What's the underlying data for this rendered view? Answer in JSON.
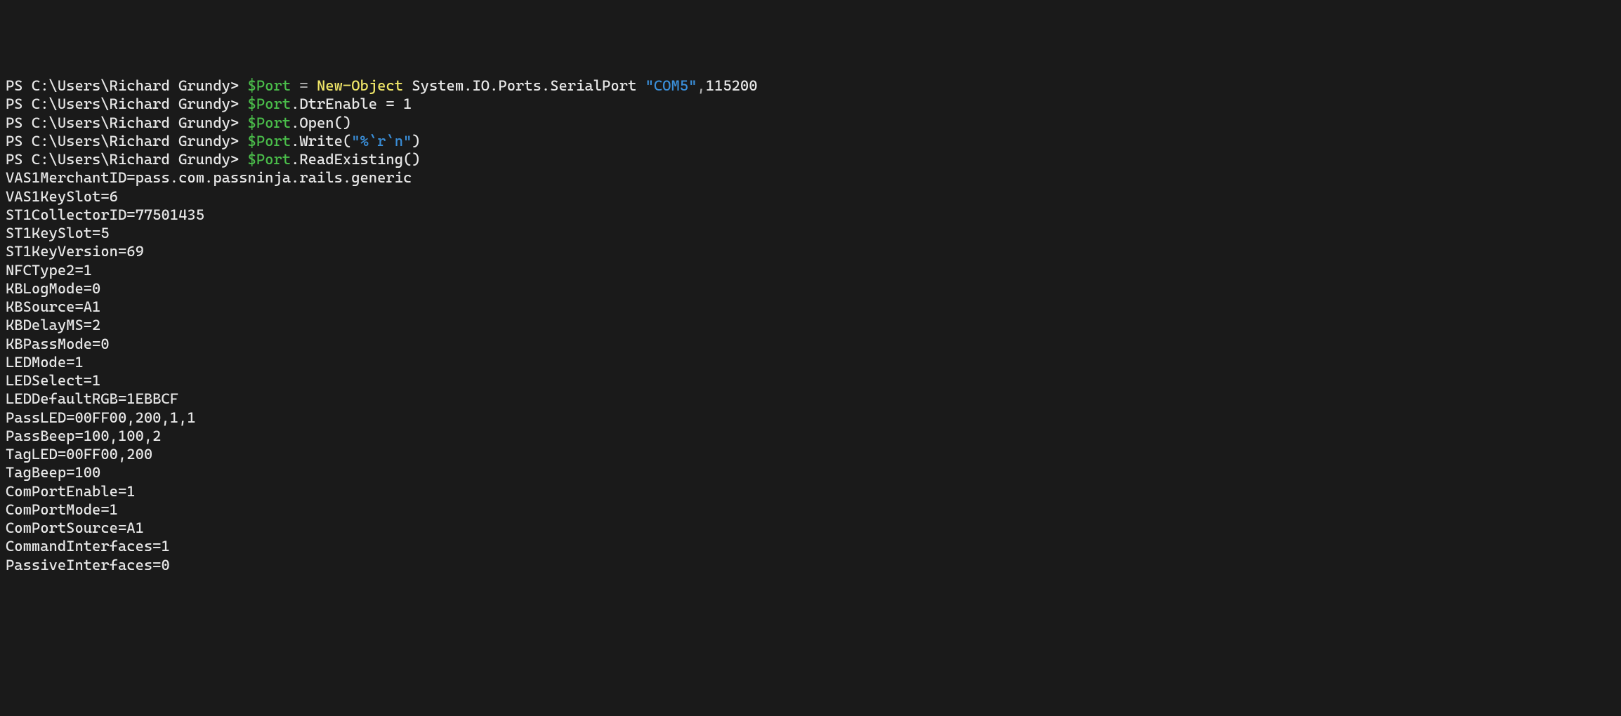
{
  "commands": [
    {
      "prompt": "PS C:\\Users\\Richard Grundy> ",
      "parts": [
        {
          "text": "$Port",
          "cls": "variable"
        },
        {
          "text": " = ",
          "cls": "operator"
        },
        {
          "text": "New-Object",
          "cls": "cmdlet"
        },
        {
          "text": " System.IO.Ports.SerialPort ",
          "cls": "type"
        },
        {
          "text": "\"COM5\"",
          "cls": "string"
        },
        {
          "text": ",",
          "cls": "operator"
        },
        {
          "text": "115200",
          "cls": "number"
        }
      ]
    },
    {
      "prompt": "PS C:\\Users\\Richard Grundy> ",
      "parts": [
        {
          "text": "$Port",
          "cls": "variable"
        },
        {
          "text": ".DtrEnable = ",
          "cls": "method"
        },
        {
          "text": "1",
          "cls": "number"
        }
      ]
    },
    {
      "prompt": "PS C:\\Users\\Richard Grundy> ",
      "parts": [
        {
          "text": "$Port",
          "cls": "variable"
        },
        {
          "text": ".Open()",
          "cls": "method"
        }
      ]
    },
    {
      "prompt": "PS C:\\Users\\Richard Grundy> ",
      "parts": [
        {
          "text": "$Port",
          "cls": "variable"
        },
        {
          "text": ".Write(",
          "cls": "method"
        },
        {
          "text": "\"%`r`n\"",
          "cls": "string"
        },
        {
          "text": ")",
          "cls": "paren"
        }
      ]
    },
    {
      "prompt": "PS C:\\Users\\Richard Grundy> ",
      "parts": [
        {
          "text": "$Port",
          "cls": "variable"
        },
        {
          "text": ".ReadExisting()",
          "cls": "method"
        }
      ]
    }
  ],
  "output": [
    "VAS1MerchantID=pass.com.passninja.rails.generic",
    "VAS1KeySlot=6",
    "ST1CollectorID=77501435",
    "ST1KeySlot=5",
    "ST1KeyVersion=69",
    "NFCType2=1",
    "KBLogMode=0",
    "KBSource=A1",
    "KBDelayMS=2",
    "KBPassMode=0",
    "LEDMode=1",
    "LEDSelect=1",
    "LEDDefaultRGB=1EBBCF",
    "PassLED=00FF00,200,1,1",
    "PassBeep=100,100,2",
    "TagLED=00FF00,200",
    "TagBeep=100",
    "ComPortEnable=1",
    "ComPortMode=1",
    "ComPortSource=A1",
    "CommandInterfaces=1",
    "PassiveInterfaces=0"
  ]
}
